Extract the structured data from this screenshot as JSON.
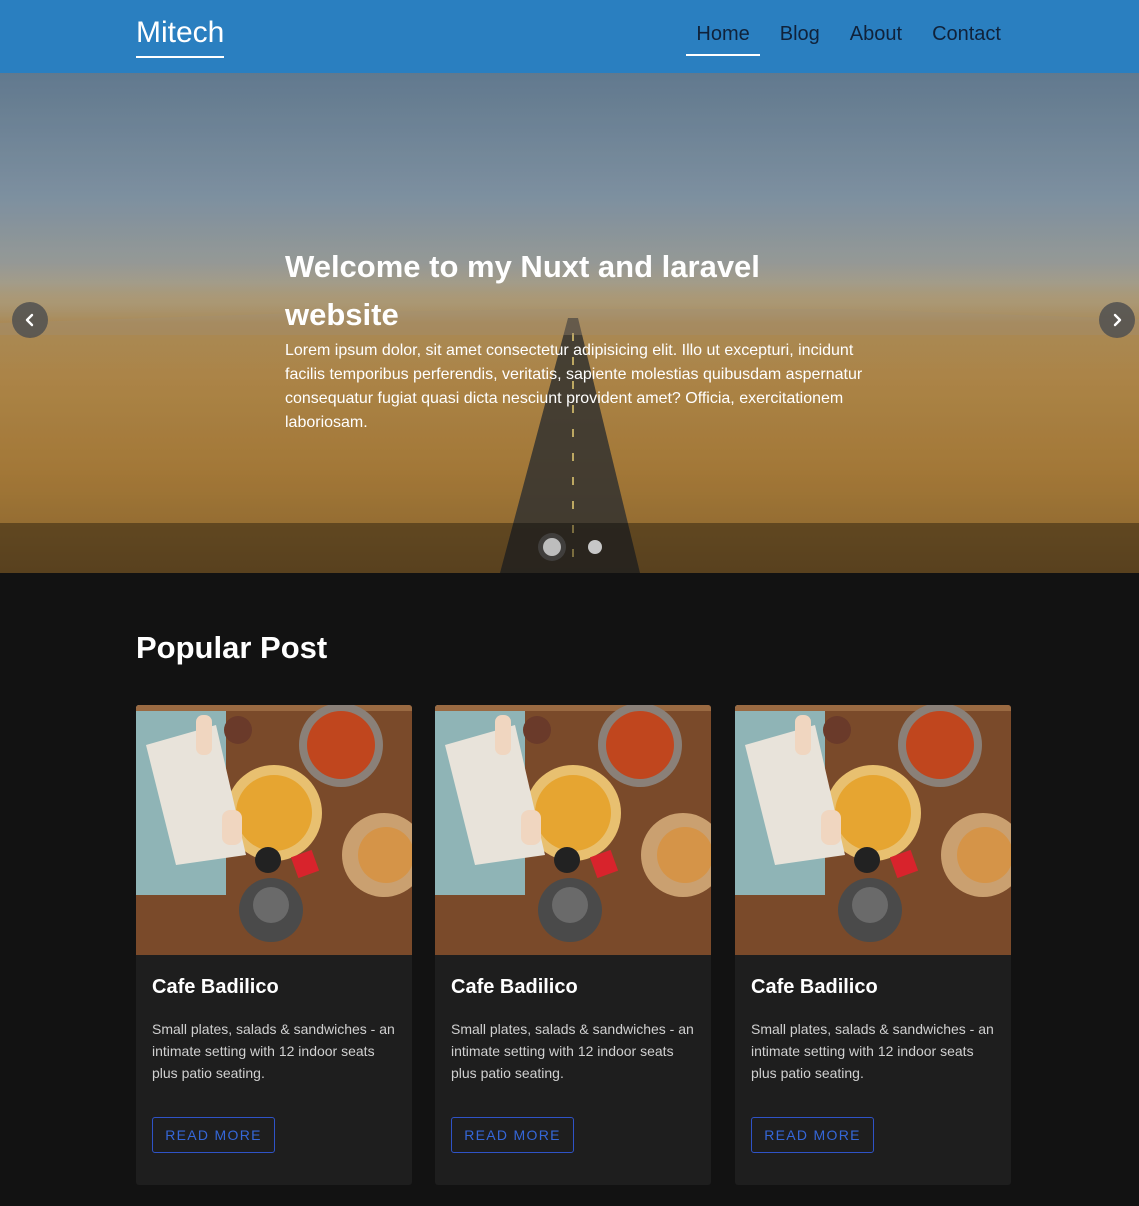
{
  "header": {
    "brand": "Mitech",
    "nav": [
      "Home",
      "Blog",
      "About",
      "Contact"
    ],
    "active_nav": "Home",
    "background_color": "#2a7fc0"
  },
  "hero": {
    "title": "Welcome to my Nuxt and laravel website",
    "body": "Lorem ipsum dolor, sit amet consectetur adipisicing elit. Illo ut excepturi, incidunt facilis temporibus perferendis, veritatis, sapiente molestias quibusdam aspernatur consequatur fugiat quasi dicta nesciunt provident amet? Officia, exercitationem laboriosam.",
    "prev_icon": "chevron-left-icon",
    "next_icon": "chevron-right-icon",
    "slide_count": 2,
    "active_slide": 1
  },
  "popular": {
    "title": "Popular Post",
    "cards": [
      {
        "title": "Cafe Badilico",
        "text": "Small plates, salads & sandwiches - an intimate setting with 12 indoor seats plus patio seating.",
        "button": "READ MORE"
      },
      {
        "title": "Cafe Badilico",
        "text": "Small plates, salads & sandwiches - an intimate setting with 12 indoor seats plus patio seating.",
        "button": "READ MORE"
      },
      {
        "title": "Cafe Badilico",
        "text": "Small plates, salads & sandwiches - an intimate setting with 12 indoor seats plus patio seating.",
        "button": "READ MORE"
      }
    ]
  },
  "colors": {
    "page_background": "#121212",
    "card_background": "#1e1e1e",
    "button_outline": "#2f53c7"
  }
}
